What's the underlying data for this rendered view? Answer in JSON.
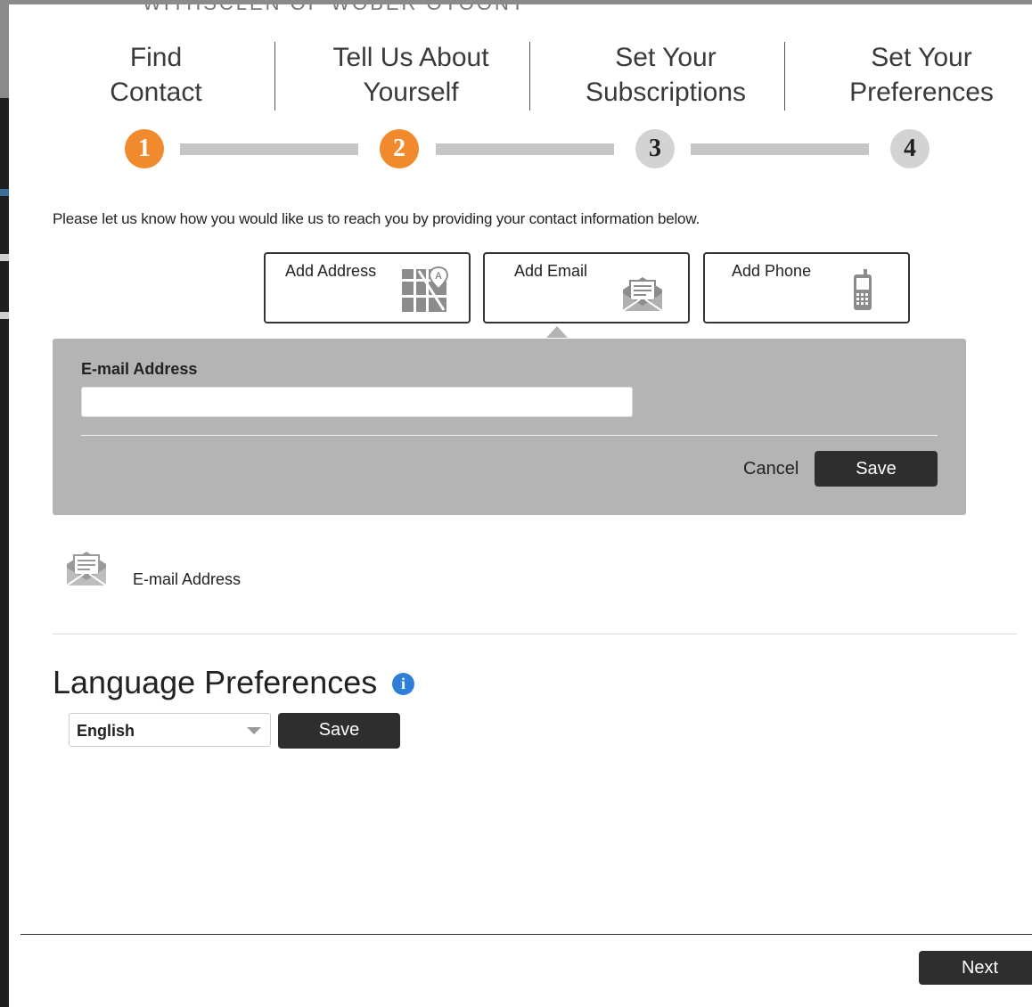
{
  "backdrop": {
    "partial_heading": "WITHSCLEN OF WOBER OTOONT"
  },
  "steps": [
    {
      "line1": "Find",
      "line2": "Contact",
      "number": "1",
      "state": "active"
    },
    {
      "line1": "Tell Us About",
      "line2": "Yourself",
      "number": "2",
      "state": "active"
    },
    {
      "line1": "Set Your",
      "line2": "Subscriptions",
      "number": "3",
      "state": "inactive"
    },
    {
      "line1": "Set Your",
      "line2": "Preferences",
      "number": "4",
      "state": "inactive"
    }
  ],
  "intro_text": "Please let us know how you would like us to reach you by providing your contact information below.",
  "contact_tiles": {
    "address": {
      "label": "Add Address",
      "icon": "map-icon"
    },
    "email": {
      "label": "Add Email",
      "icon": "envelope-icon"
    },
    "phone": {
      "label": "Add Phone",
      "icon": "mobile-phone-icon"
    }
  },
  "email_panel": {
    "field_label": "E-mail Address",
    "field_value": "",
    "cancel_label": "Cancel",
    "save_label": "Save"
  },
  "saved_contact": {
    "icon": "envelope-icon",
    "label": "E-mail Address"
  },
  "language": {
    "title": "Language Preferences",
    "info_icon": "info-icon",
    "selected": "English",
    "save_label": "Save"
  },
  "footer": {
    "next_label": "Next"
  },
  "colors": {
    "accent_orange": "#f08a2c",
    "inactive_step": "#d3d3d3",
    "panel_gray": "#b4b4b4",
    "button_dark": "#2e2e2e",
    "info_blue": "#2f7fd9"
  }
}
